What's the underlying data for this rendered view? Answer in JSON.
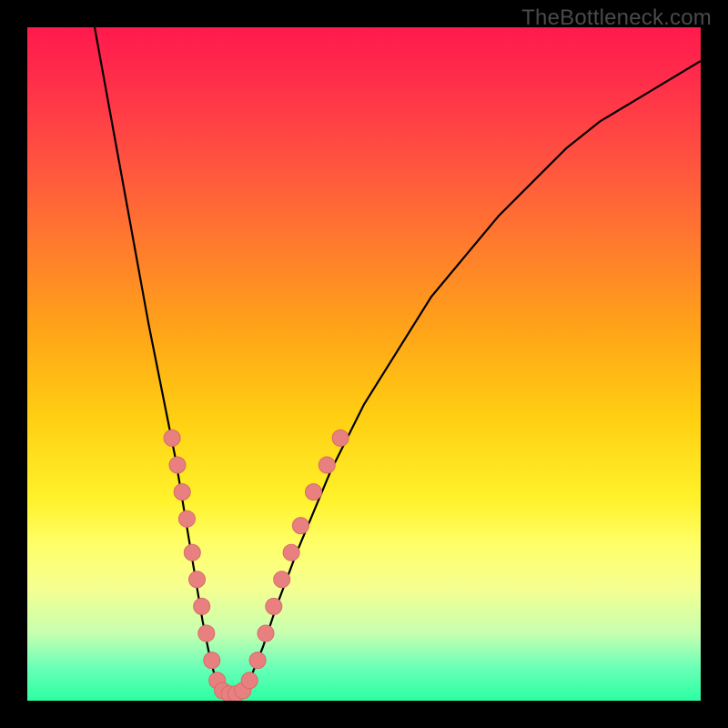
{
  "watermark": "TheBottleneck.com",
  "colors": {
    "frame": "#000000",
    "curve": "#000000",
    "marker_fill": "#e98080",
    "marker_stroke": "#d86a6a",
    "gradient_top": "#ff1a4d",
    "gradient_bottom": "#2bffa1"
  },
  "chart_data": {
    "type": "line",
    "title": "",
    "xlabel": "",
    "ylabel": "",
    "xlim": [
      0,
      100
    ],
    "ylim": [
      0,
      100
    ],
    "grid": false,
    "series": [
      {
        "name": "bottleneck-curve",
        "description": "V-shaped bottleneck curve. Y = bottleneck % (0 at minimum, 100 at top). X = relative component balance (arbitrary 0-100).",
        "x": [
          10,
          12,
          14,
          16,
          18,
          20,
          22,
          24,
          25,
          26,
          27,
          28,
          29,
          30,
          31,
          32,
          33,
          35,
          37,
          40,
          45,
          50,
          55,
          60,
          65,
          70,
          75,
          80,
          85,
          90,
          95,
          100
        ],
        "y": [
          100,
          89,
          78,
          67,
          56,
          46,
          36,
          24,
          18,
          12,
          7,
          3,
          1,
          0,
          0,
          1,
          3,
          8,
          14,
          22,
          34,
          44,
          52,
          60,
          66,
          72,
          77,
          82,
          86,
          89,
          92,
          95
        ]
      }
    ],
    "markers": {
      "name": "highlighted-points",
      "description": "Salmon dot markers clustered near the bottom of the V shape on both arms.",
      "points": [
        {
          "x": 21.5,
          "y": 39
        },
        {
          "x": 22.3,
          "y": 35
        },
        {
          "x": 23.0,
          "y": 31
        },
        {
          "x": 23.7,
          "y": 27
        },
        {
          "x": 24.5,
          "y": 22
        },
        {
          "x": 25.2,
          "y": 18
        },
        {
          "x": 25.9,
          "y": 14
        },
        {
          "x": 26.6,
          "y": 10
        },
        {
          "x": 27.4,
          "y": 6
        },
        {
          "x": 28.2,
          "y": 3
        },
        {
          "x": 29.0,
          "y": 1.5
        },
        {
          "x": 30.0,
          "y": 1
        },
        {
          "x": 31.0,
          "y": 1
        },
        {
          "x": 32.0,
          "y": 1.5
        },
        {
          "x": 33.0,
          "y": 3
        },
        {
          "x": 34.2,
          "y": 6
        },
        {
          "x": 35.4,
          "y": 10
        },
        {
          "x": 36.6,
          "y": 14
        },
        {
          "x": 37.8,
          "y": 18
        },
        {
          "x": 39.2,
          "y": 22
        },
        {
          "x": 40.6,
          "y": 26
        },
        {
          "x": 42.5,
          "y": 31
        },
        {
          "x": 44.5,
          "y": 35
        },
        {
          "x": 46.5,
          "y": 39
        }
      ]
    }
  }
}
